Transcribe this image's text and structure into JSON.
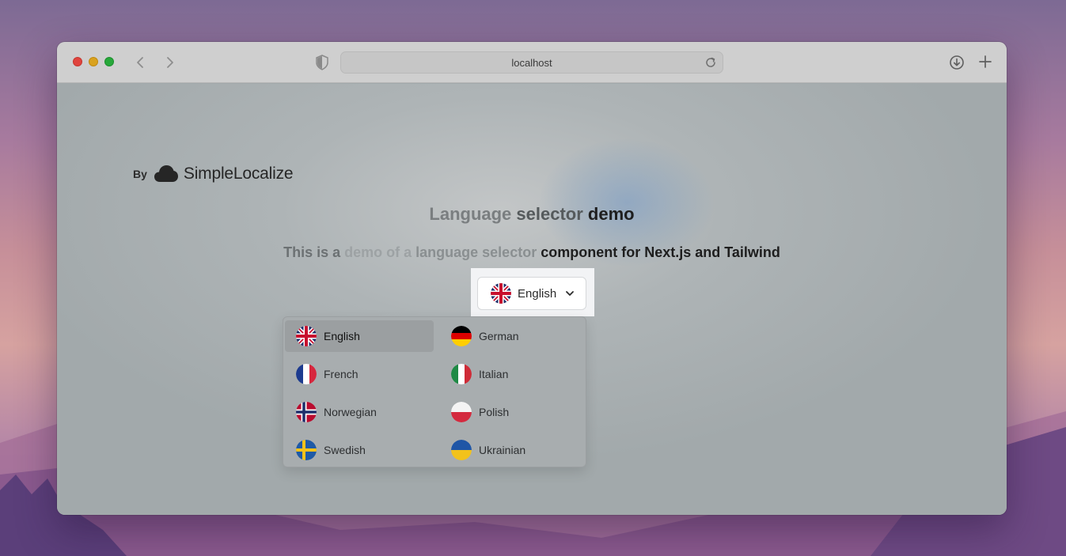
{
  "browser": {
    "url": "localhost"
  },
  "brand": {
    "by": "By",
    "name": "SimpleLocalize"
  },
  "page": {
    "title_parts": [
      "Language",
      " selector",
      " demo"
    ],
    "subtitle_parts": [
      "This is a ",
      "demo of a ",
      "language selector ",
      "component for Next.js and Tailwind"
    ]
  },
  "selector": {
    "current": "English",
    "current_flag": "uk-flag-icon"
  },
  "languages": [
    {
      "label": "English",
      "flag": "uk-flag-icon",
      "active": true
    },
    {
      "label": "German",
      "flag": "germany-flag-icon"
    },
    {
      "label": "French",
      "flag": "france-flag-icon"
    },
    {
      "label": "Italian",
      "flag": "italy-flag-icon"
    },
    {
      "label": "Norwegian",
      "flag": "norway-flag-icon"
    },
    {
      "label": "Polish",
      "flag": "poland-flag-icon"
    },
    {
      "label": "Swedish",
      "flag": "sweden-flag-icon"
    },
    {
      "label": "Ukrainian",
      "flag": "ukraine-flag-icon"
    }
  ],
  "colors": {
    "accent_dark": "#1e1e1e",
    "dropdown_bg": "#a8adaf",
    "highlight": "#f2f3f5"
  }
}
